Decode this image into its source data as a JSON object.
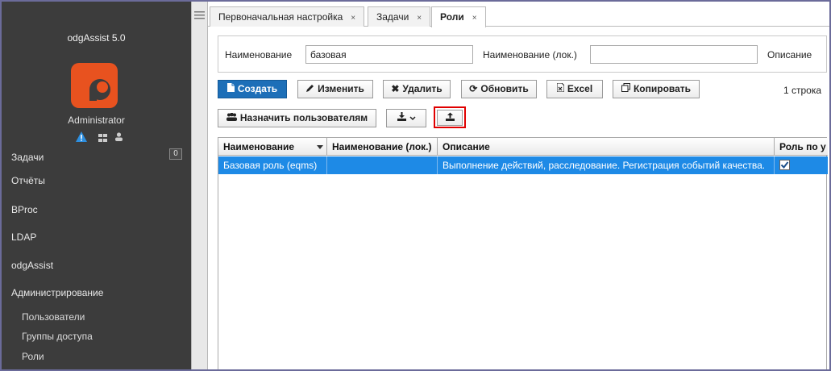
{
  "sidebar": {
    "app_title": "odgAssist 5.0",
    "username": "Administrator",
    "icons": [
      "warning-icon",
      "grid-icon",
      "users-icon"
    ],
    "nav": {
      "tasks": "Задачи",
      "tasks_badge": "0",
      "reports": "Отчёты",
      "bproc": "BProc",
      "ldap": "LDAP",
      "odgassist": "odgAssist",
      "admin": "Администрирование",
      "users": "Пользователи",
      "access_groups": "Группы доступа",
      "roles": "Роли"
    }
  },
  "tabs": {
    "initial_setup": "Первоначальная настройка",
    "tasks": "Задачи",
    "roles": "Роли",
    "close_glyph": "×"
  },
  "filter": {
    "name_label": "Наименование",
    "name_value": "базовая",
    "local_name_label": "Наименование (лок.)",
    "local_name_value": "",
    "description_label": "Описание"
  },
  "toolbar": {
    "create": "Создать",
    "edit": "Изменить",
    "delete": "Удалить",
    "refresh": "Обновить",
    "excel": "Excel",
    "copy": "Копировать",
    "assign_users": "Назначить пользователям",
    "row_count": "1 строка"
  },
  "grid": {
    "columns": {
      "name": "Наименование",
      "local_name": "Наименование (лок.)",
      "description": "Описание",
      "user_role": "Роль по у"
    },
    "rows": [
      {
        "name": "Базовая роль (eqms)",
        "local_name": "",
        "description": "Выполнение действий, расследование. Регистрация событий качества.",
        "user_role": true
      }
    ]
  },
  "colors": {
    "sidebar_bg": "#3c3c3c",
    "accent": "#1d6fb8",
    "selected_row": "#1e8ae6",
    "logo": "#e8521f",
    "highlight": "#e00000"
  }
}
